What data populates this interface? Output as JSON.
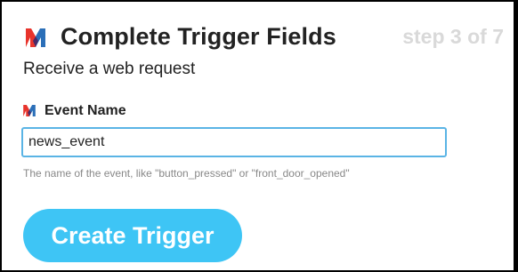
{
  "header": {
    "logo_icon": "maker-logo-icon",
    "title": "Complete Trigger Fields",
    "step": "step 3 of 7"
  },
  "trigger": {
    "description": "Receive a web request"
  },
  "field": {
    "icon": "maker-logo-icon",
    "label": "Event Name",
    "value": "news_event",
    "helper": "The name of the event, like \"button_pressed\" or \"front_door_opened\""
  },
  "actions": {
    "create_label": "Create Trigger"
  },
  "colors": {
    "logo_red": "#e8342c",
    "logo_blue": "#2b6fb8",
    "logo_purple": "#4b2a68",
    "title": "#222222",
    "step": "#d9d9d9",
    "input_border": "#5ab4e5",
    "helper_text": "#888888",
    "button": "#3ec5f5",
    "button_text": "#ffffff"
  }
}
